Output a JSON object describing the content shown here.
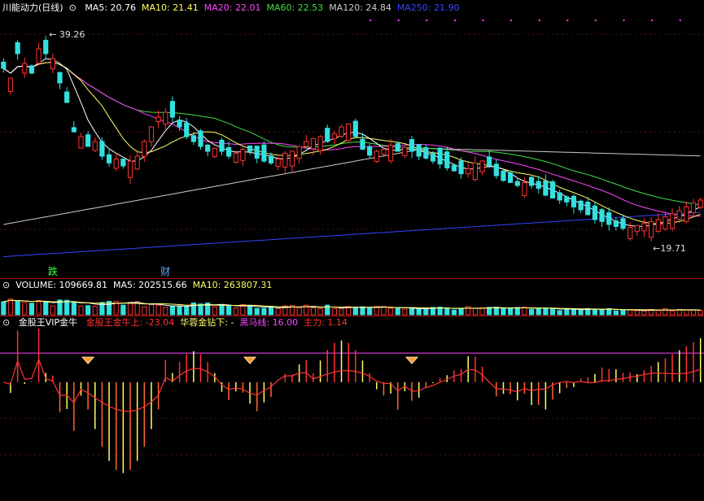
{
  "title": "川能动力(日线)",
  "ma_legend": [
    {
      "label": "MA5: 20.76",
      "color": "#ffffff"
    },
    {
      "label": "MA10: 21.41",
      "color": "#ffff66"
    },
    {
      "label": "MA20: 22.01",
      "color": "#ff44ff"
    },
    {
      "label": "MA60: 22.53",
      "color": "#44dd44"
    },
    {
      "label": "MA120: 24.84",
      "color": "#cccccc"
    },
    {
      "label": "MA250: 21.90",
      "color": "#3344ff"
    }
  ],
  "volume_legend": [
    {
      "label": "VOLUME: 109669.81",
      "color": "#ffffff"
    },
    {
      "label": "MA5: 202515.66",
      "color": "#ffffff"
    },
    {
      "label": "MA10: 263807.31",
      "color": "#ffff66"
    }
  ],
  "indicator_legend": {
    "name": "金股王VIP金牛",
    "items": [
      {
        "label": "金股王金牛上: -23.04",
        "color": "#ff3333"
      },
      {
        "label": "华蓉金钻下: -",
        "color": "#ffff66"
      },
      {
        "label": "黑马线: 16.00",
        "color": "#ff44ff"
      },
      {
        "label": "主力: 1.14",
        "color": "#ff3333"
      }
    ]
  },
  "colors": {
    "up": "#ff3333",
    "down": "#33e0e0",
    "ma5": "#ffffff",
    "ma10": "#ffff66",
    "ma20": "#ff44ff",
    "ma60": "#44dd44",
    "ma120": "#cccccc",
    "ma250": "#3344ff"
  },
  "chart_data": {
    "type": "candlestick",
    "price_ylim": [
      16,
      42
    ],
    "high_annotation": "39.26",
    "low_annotation": "19.71",
    "events": [
      {
        "index": 7,
        "label": "跌",
        "color": "#44ff44"
      },
      {
        "index": 23,
        "label": "财",
        "color": "#66aaff"
      }
    ],
    "closes": [
      36.5,
      35.5,
      38,
      37,
      36,
      38.5,
      38,
      37.5,
      35,
      33,
      30,
      29.5,
      28.5,
      29,
      27.5,
      26.8,
      27.2,
      26.5,
      27,
      27.5,
      29,
      30.5,
      31.5,
      32,
      31.5,
      30.5,
      29.5,
      29,
      28.5,
      28,
      28.3,
      28,
      27.5,
      27.8,
      28.2,
      28,
      27.3,
      27,
      26.8,
      27.2,
      27.8,
      28,
      28.5,
      29,
      29.3,
      29.5,
      29,
      29.8,
      30.5,
      30.8,
      29.5,
      28.2,
      27.6,
      28,
      28.2,
      28.6,
      28,
      28.4,
      28,
      27.5,
      27.3,
      27,
      26.7,
      26.3,
      26,
      25.7,
      26.2,
      26.8,
      27,
      26.5,
      25.5,
      25,
      24.8,
      24.5,
      24.8,
      24.5,
      24.2,
      23.5,
      23.2,
      23,
      22.8,
      22.3,
      22,
      21.5,
      21,
      20.8,
      20.5,
      20.3,
      20.1,
      20.2,
      20.4,
      20.6,
      20.8,
      21,
      21.3,
      21.6,
      21.9,
      22.3,
      22.7,
      23
    ],
    "candle_up": [
      0,
      1,
      0,
      1,
      0,
      1,
      0,
      1,
      0,
      0,
      0,
      1,
      0,
      1,
      0,
      0,
      1,
      0,
      1,
      1,
      1,
      1,
      1,
      1,
      0,
      0,
      0,
      0,
      0,
      0,
      1,
      0,
      0,
      1,
      1,
      0,
      0,
      0,
      0,
      1,
      1,
      1,
      1,
      1,
      1,
      1,
      0,
      1,
      1,
      1,
      0,
      0,
      0,
      1,
      1,
      1,
      0,
      1,
      0,
      0,
      0,
      0,
      0,
      0,
      0,
      0,
      1,
      1,
      1,
      0,
      0,
      0,
      0,
      0,
      1,
      0,
      0,
      0,
      0,
      0,
      0,
      0,
      0,
      0,
      0,
      0,
      0,
      0,
      0,
      1,
      1,
      1,
      1,
      1,
      1,
      1,
      1,
      1,
      1,
      1
    ],
    "volume_ylim": [
      0,
      600000
    ],
    "indicator_ylim": [
      -60,
      25
    ],
    "heima_level": 16,
    "diamonds": [
      12,
      35,
      58
    ]
  }
}
